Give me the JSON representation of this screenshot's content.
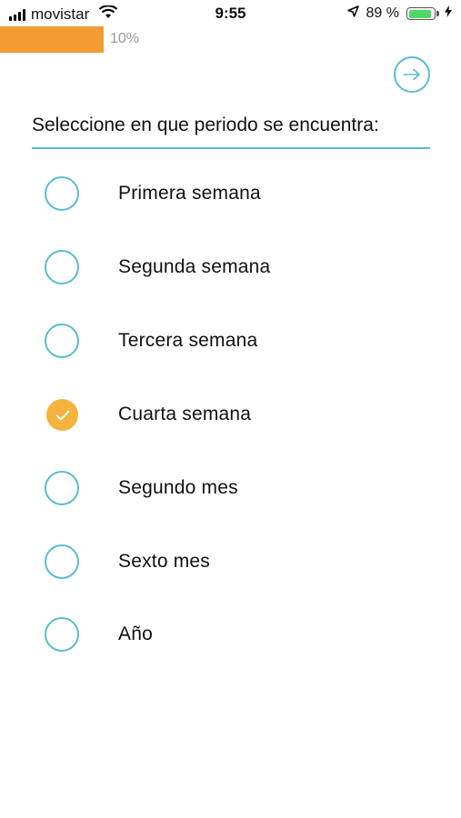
{
  "status_bar": {
    "carrier": "movistar",
    "time": "9:55",
    "battery_percent": "89 %",
    "battery_level": 0.89,
    "icons": [
      "signal-bars-icon",
      "wifi-icon",
      "location-arrow-icon",
      "battery-icon",
      "charging-bolt-icon"
    ]
  },
  "progress": {
    "label": "10%",
    "value": 0.1,
    "color": "#f39c33"
  },
  "navigation": {
    "next_icon": "arrow-right-circle-icon"
  },
  "question": {
    "title": "Seleccione en que periodo se encuentra:",
    "accent_color": "#5bbccc"
  },
  "options": [
    {
      "label": "Primera semana",
      "selected": false
    },
    {
      "label": "Segunda semana",
      "selected": false
    },
    {
      "label": "Tercera semana",
      "selected": false
    },
    {
      "label": "Cuarta semana",
      "selected": true
    },
    {
      "label": "Segundo mes",
      "selected": false
    },
    {
      "label": "Sexto mes",
      "selected": false
    },
    {
      "label": "Año",
      "selected": false
    }
  ],
  "colors": {
    "selected": "#f4b33e",
    "unselected_ring": "#5bbccc"
  }
}
